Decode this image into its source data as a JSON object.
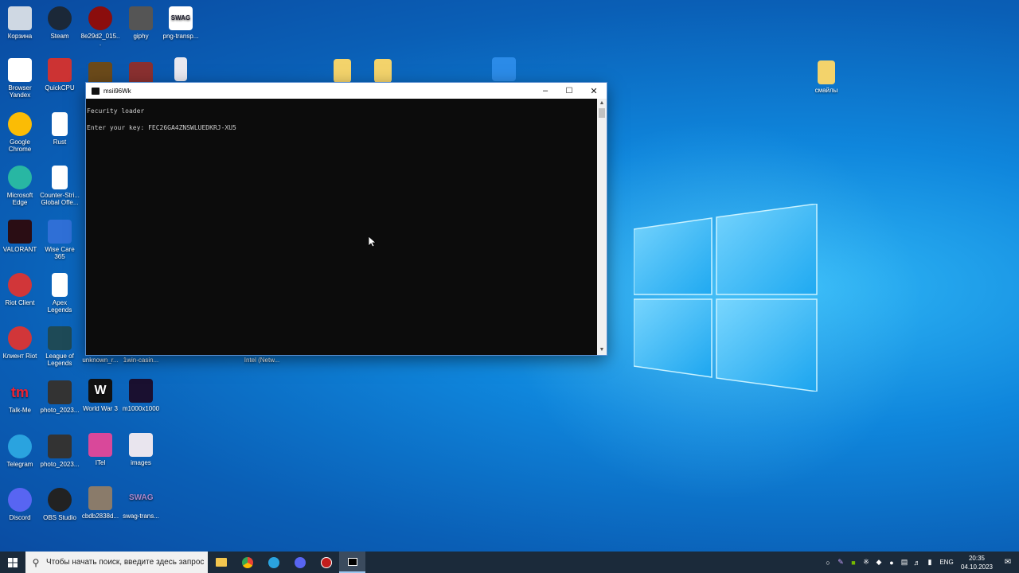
{
  "desktop": {
    "icons_col1": [
      {
        "label": "Корзина",
        "icon": "recycle-bin-icon"
      },
      {
        "label": "Browser Yandex",
        "icon": "yandex-browser-icon"
      },
      {
        "label": "Google Chrome",
        "icon": "chrome-icon"
      },
      {
        "label": "Microsoft Edge",
        "icon": "edge-icon"
      },
      {
        "label": "VALORANT",
        "icon": "valorant-icon"
      },
      {
        "label": "Riot Client",
        "icon": "riot-icon"
      },
      {
        "label": "Клиент Riot",
        "icon": "riot-icon"
      },
      {
        "label": "Talk-Me",
        "icon": "talkme-icon"
      },
      {
        "label": "Telegram",
        "icon": "telegram-icon"
      },
      {
        "label": "Discord",
        "icon": "discord-icon"
      }
    ],
    "icons_col2": [
      {
        "label": "Steam",
        "icon": "steam-icon"
      },
      {
        "label": "QuickCPU",
        "icon": "quickcpu-icon"
      },
      {
        "label": "Rust",
        "icon": "file-icon"
      },
      {
        "label": "Counter-Stri... Global Offe...",
        "icon": "file-icon"
      },
      {
        "label": "Wise Care 365",
        "icon": "wisecare-icon"
      },
      {
        "label": "Apex Legends",
        "icon": "file-icon"
      },
      {
        "label": "League of Legends",
        "icon": "lol-icon"
      },
      {
        "label": "photo_2023...",
        "icon": "image-icon"
      },
      {
        "label": "photo_2023...",
        "icon": "image-icon"
      },
      {
        "label": "OBS Studio",
        "icon": "obs-icon"
      }
    ],
    "icons_col3": [
      {
        "label": "8e29d2_015...",
        "icon": "image-icon"
      },
      {
        "label": "unknown_r...",
        "icon": "image-icon"
      },
      {
        "label": "World War 3",
        "icon": "ww3-icon"
      },
      {
        "label": "ITel",
        "icon": "image-icon"
      },
      {
        "label": "cbdb2838d...",
        "icon": "image-icon"
      }
    ],
    "icons_col4": [
      {
        "label": "giphy",
        "icon": "image-icon"
      },
      {
        "label": "1win-casin...",
        "icon": "image-icon"
      },
      {
        "label": "m1000x1000",
        "icon": "image-icon"
      },
      {
        "label": "images",
        "icon": "image-icon"
      },
      {
        "label": "swag-trans...",
        "icon": "image-icon"
      }
    ],
    "icons_misc": [
      {
        "label": "png-transp...",
        "icon": "image-icon"
      },
      {
        "label": "Intel (Netw...",
        "icon": "file-icon"
      },
      {
        "label": "смайлы",
        "icon": "folder-icon"
      }
    ]
  },
  "console": {
    "title": "msii96Wk",
    "lines": [
      "Fecurity loader",
      "Enter your key: FEC26GA4ZNSWLUEDKRJ-XU5"
    ]
  },
  "taskbar": {
    "search_placeholder": "Чтобы начать поиск, введите здесь запрос",
    "lang": "ENG",
    "time": "20:35",
    "date": "04.10.2023",
    "notifications": "1"
  }
}
